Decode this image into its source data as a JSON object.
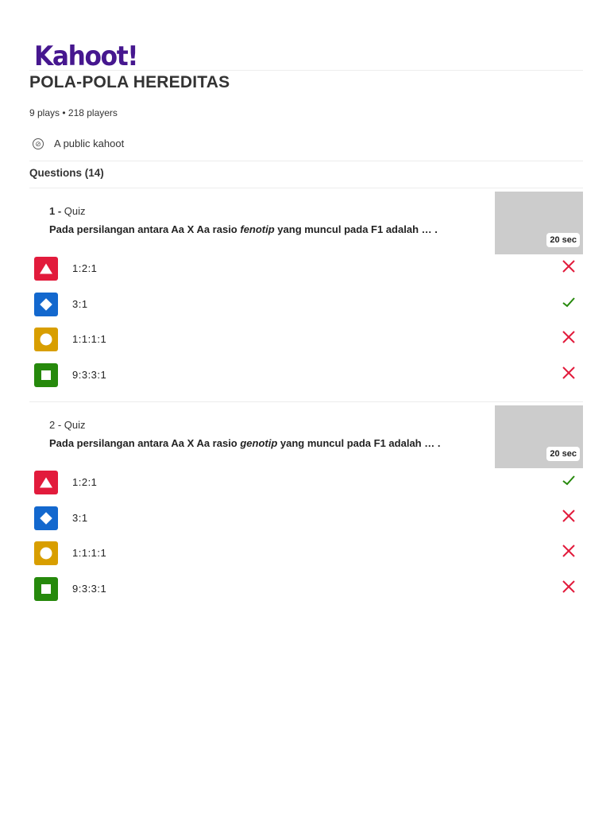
{
  "logo": "Kahoot!",
  "title": "POLA-POLA HEREDITAS",
  "meta": "9 plays • 218 players",
  "public_label": "A public kahoot",
  "questions_heading": "Questions (14)",
  "colors": {
    "red": "#e21b3c",
    "blue": "#1368ce",
    "yellow": "#d89e00",
    "green": "#26890c",
    "correct": "#26890c",
    "wrong": "#e21b3c",
    "brand": "#46178f"
  },
  "questions": [
    {
      "number": "1 -",
      "type": " Quiz",
      "text_before": "Pada persilangan antara Aa X Aa rasio ",
      "text_italic": "fenotip",
      "text_after": " yang muncul pada F1 adalah … .",
      "time": "20 sec",
      "answers": [
        {
          "shape": "triangle-icon",
          "text": "1:2:1",
          "correct": false
        },
        {
          "shape": "diamond-icon",
          "text": "3:1",
          "correct": true
        },
        {
          "shape": "circle-icon",
          "text": "1:1:1:1",
          "correct": false
        },
        {
          "shape": "square-icon",
          "text": "9:3:3:1",
          "correct": false
        }
      ]
    },
    {
      "number": "2 -",
      "type": " Quiz",
      "text_before": "Pada persilangan antara Aa X Aa rasio ",
      "text_italic": "genotip",
      "text_after": " yang muncul pada F1 adalah … .",
      "time": "20 sec",
      "answers": [
        {
          "shape": "triangle-icon",
          "text": "1:2:1",
          "correct": true
        },
        {
          "shape": "diamond-icon",
          "text": "3:1",
          "correct": false
        },
        {
          "shape": "circle-icon",
          "text": "1:1:1:1",
          "correct": false
        },
        {
          "shape": "square-icon",
          "text": "9:3:3:1",
          "correct": false
        }
      ]
    }
  ]
}
